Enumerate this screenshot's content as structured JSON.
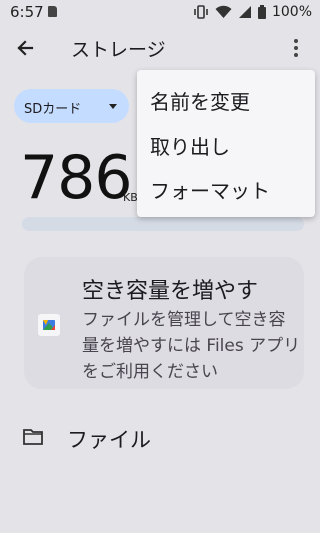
{
  "status_bar": {
    "time": "6:57",
    "battery_percent": "100%",
    "icons": [
      "sd-card-icon",
      "vibrate-icon",
      "wifi-icon",
      "signal-icon",
      "battery-icon"
    ]
  },
  "toolbar": {
    "title": "ストレージ",
    "back_icon": "arrow-back-icon",
    "more_icon": "more-vert-icon"
  },
  "volume_selector": {
    "label": "SDカード",
    "icon": "dropdown-arrow-icon",
    "chip_color": "#c4dcff"
  },
  "usage": {
    "amount": "786",
    "unit": "KB"
  },
  "freeup_card": {
    "title": "空き容量を増やす",
    "body": "ファイルを管理して空き容量を増やすには Files アプリをご利用ください",
    "icon": "files-app-icon"
  },
  "files_row": {
    "label": "ファイル",
    "icon": "folder-icon"
  },
  "overflow_menu": {
    "items": [
      {
        "label": "名前を変更"
      },
      {
        "label": "取り出し"
      },
      {
        "label": "フォーマット"
      }
    ]
  },
  "colors": {
    "background": "#e4e3e8",
    "menu_background": "#f6f6f8",
    "accent": "#c4dcff"
  }
}
